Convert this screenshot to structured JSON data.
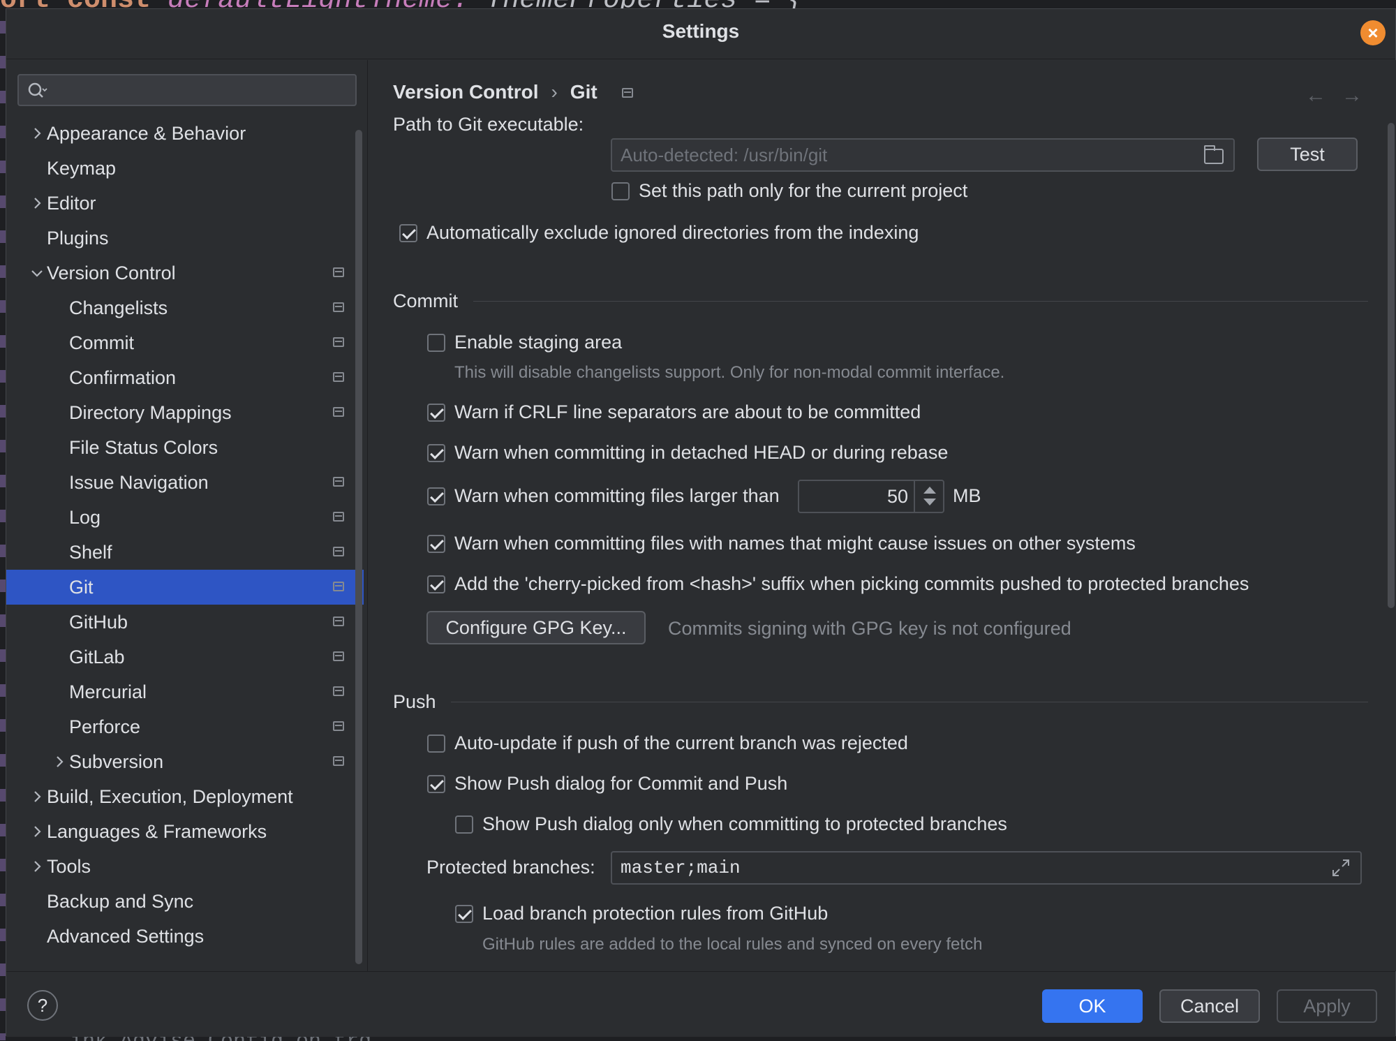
{
  "background": {
    "code_keyword": "ort const",
    "code_identifier": "defaultLightTheme:",
    "code_type": "ThemeProperties = {",
    "bottom_text": "ink  Advise  Config  on  trd"
  },
  "dialog": {
    "title": "Settings"
  },
  "sidebar": {
    "search_placeholder": "",
    "items": [
      {
        "label": "Appearance & Behavior",
        "level": 0,
        "expandable": true,
        "expanded": false,
        "scope": false
      },
      {
        "label": "Keymap",
        "level": 0,
        "expandable": false,
        "scope": false
      },
      {
        "label": "Editor",
        "level": 0,
        "expandable": true,
        "expanded": false,
        "scope": false
      },
      {
        "label": "Plugins",
        "level": 0,
        "expandable": false,
        "scope": false
      },
      {
        "label": "Version Control",
        "level": 0,
        "expandable": true,
        "expanded": true,
        "scope": true
      },
      {
        "label": "Changelists",
        "level": 1,
        "scope": true
      },
      {
        "label": "Commit",
        "level": 1,
        "scope": true
      },
      {
        "label": "Confirmation",
        "level": 1,
        "scope": true
      },
      {
        "label": "Directory Mappings",
        "level": 1,
        "scope": true
      },
      {
        "label": "File Status Colors",
        "level": 1,
        "scope": false
      },
      {
        "label": "Issue Navigation",
        "level": 1,
        "scope": true
      },
      {
        "label": "Log",
        "level": 1,
        "scope": true
      },
      {
        "label": "Shelf",
        "level": 1,
        "scope": true
      },
      {
        "label": "Git",
        "level": 1,
        "scope": true,
        "selected": true
      },
      {
        "label": "GitHub",
        "level": 1,
        "scope": true
      },
      {
        "label": "GitLab",
        "level": 1,
        "scope": true
      },
      {
        "label": "Mercurial",
        "level": 1,
        "scope": true
      },
      {
        "label": "Perforce",
        "level": 1,
        "scope": true
      },
      {
        "label": "Subversion",
        "level": 1,
        "expandable": true,
        "expanded": false,
        "scope": true
      },
      {
        "label": "Build, Execution, Deployment",
        "level": 0,
        "expandable": true,
        "expanded": false,
        "scope": false
      },
      {
        "label": "Languages & Frameworks",
        "level": 0,
        "expandable": true,
        "expanded": false,
        "scope": false
      },
      {
        "label": "Tools",
        "level": 0,
        "expandable": true,
        "expanded": false,
        "scope": false
      },
      {
        "label": "Backup and Sync",
        "level": 0,
        "expandable": false,
        "scope": false
      },
      {
        "label": "Advanced Settings",
        "level": 0,
        "expandable": false,
        "scope": false
      }
    ]
  },
  "breadcrumb": {
    "parent": "Version Control",
    "separator": "›",
    "current": "Git"
  },
  "nav": {
    "back": "←",
    "forward": "→"
  },
  "git": {
    "path_label": "Path to Git executable:",
    "path_placeholder": "Auto-detected: /usr/bin/git",
    "test_button": "Test",
    "project_only_label": "Set this path only for the current project",
    "project_only_checked": false,
    "exclude_ignored_label": "Automatically exclude ignored directories from the indexing",
    "exclude_ignored_checked": true
  },
  "commit": {
    "section_title": "Commit",
    "staging_label": "Enable staging area",
    "staging_checked": false,
    "staging_hint": "This will disable changelists support. Only for non-modal commit interface.",
    "crlf_label": "Warn if CRLF line separators are about to be committed",
    "crlf_checked": true,
    "detached_label": "Warn when committing in detached HEAD or during rebase",
    "detached_checked": true,
    "large_files_label": "Warn when committing files larger than",
    "large_files_checked": true,
    "large_files_value": "50",
    "large_files_unit": "MB",
    "names_label": "Warn when committing files with names that might cause issues on other systems",
    "names_checked": true,
    "cherry_label": "Add the 'cherry-picked from <hash>' suffix when picking commits pushed to protected branches",
    "cherry_checked": true,
    "gpg_button": "Configure GPG Key...",
    "gpg_status": "Commits signing with GPG key is not configured"
  },
  "push": {
    "section_title": "Push",
    "auto_update_label": "Auto-update if push of the current branch was rejected",
    "auto_update_checked": false,
    "show_dialog_label": "Show Push dialog for Commit and Push",
    "show_dialog_checked": true,
    "protected_only_label": "Show Push dialog only when committing to protected branches",
    "protected_only_checked": false,
    "protected_branches_label": "Protected branches:",
    "protected_branches_value": "master;main",
    "load_rules_label": "Load branch protection rules from GitHub",
    "load_rules_checked": true,
    "load_rules_hint": "GitHub rules are added to the local rules and synced on every fetch"
  },
  "footer": {
    "help": "?",
    "ok": "OK",
    "cancel": "Cancel",
    "apply": "Apply"
  },
  "colors": {
    "accent": "#3574f0",
    "selection": "#2e55c4",
    "close": "#f08c30",
    "background": "#2b2d30"
  }
}
